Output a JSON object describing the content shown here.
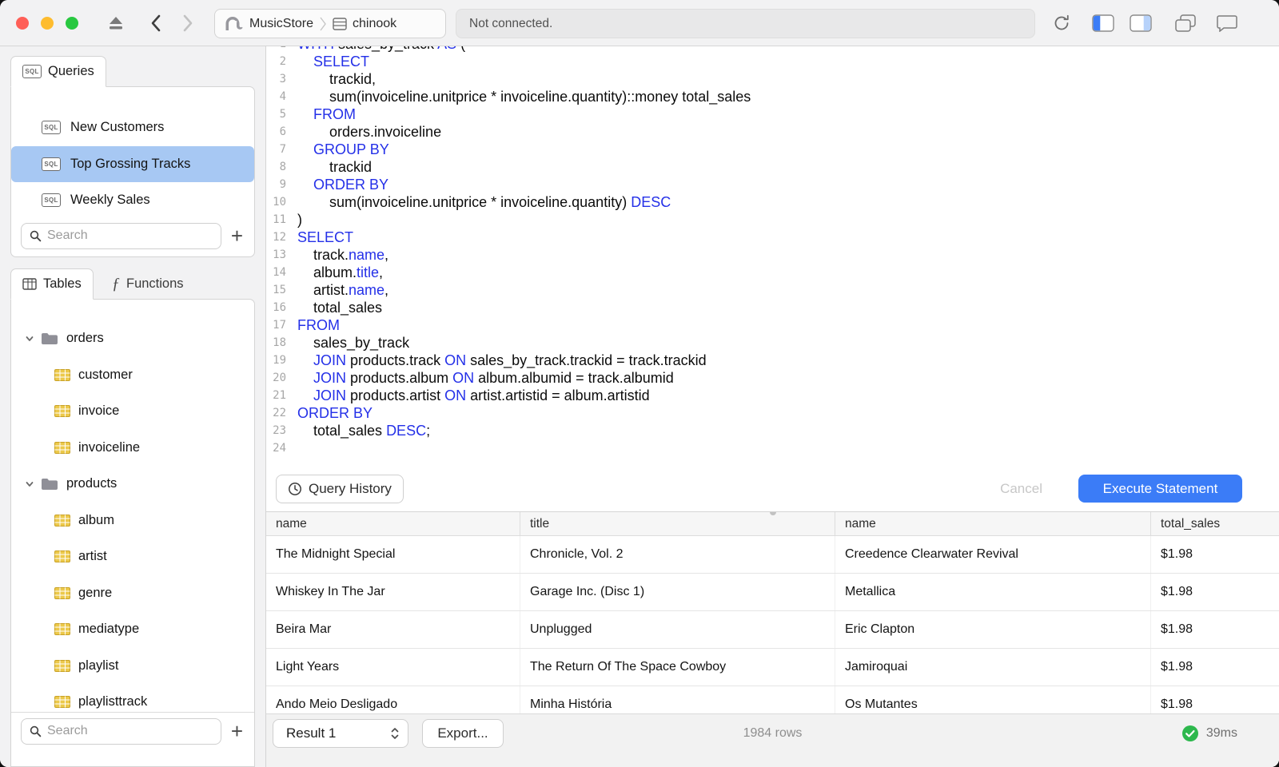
{
  "toolbar": {
    "status_text": "Not connected.",
    "breadcrumb": {
      "server": "MusicStore",
      "database": "chinook"
    }
  },
  "sidebar": {
    "queries_tab_label": "Queries",
    "queries": [
      {
        "label": "New Customers",
        "selected": false
      },
      {
        "label": "Top Grossing Tracks",
        "selected": true
      },
      {
        "label": "Weekly Sales",
        "selected": false
      }
    ],
    "queries_search_placeholder": "Search",
    "tables_tab_label": "Tables",
    "functions_tab_label": "Functions",
    "tree": [
      {
        "kind": "schema",
        "label": "orders"
      },
      {
        "kind": "table",
        "label": "customer"
      },
      {
        "kind": "table",
        "label": "invoice"
      },
      {
        "kind": "table",
        "label": "invoiceline"
      },
      {
        "kind": "schema",
        "label": "products"
      },
      {
        "kind": "table",
        "label": "album"
      },
      {
        "kind": "table",
        "label": "artist"
      },
      {
        "kind": "table",
        "label": "genre"
      },
      {
        "kind": "table",
        "label": "mediatype"
      },
      {
        "kind": "table",
        "label": "playlist"
      },
      {
        "kind": "table",
        "label": "playlisttrack"
      }
    ],
    "tables_search_placeholder": "Search"
  },
  "editor": {
    "first_line_number": 1,
    "lines": [
      [
        [
          "k",
          "WITH"
        ],
        [
          "p",
          " sales_by_track "
        ],
        [
          "k",
          "AS"
        ],
        [
          "p",
          " ("
        ]
      ],
      [
        [
          "p",
          "    "
        ],
        [
          "k",
          "SELECT"
        ]
      ],
      [
        [
          "p",
          "        trackid,"
        ]
      ],
      [
        [
          "p",
          "        sum(invoiceline.unitprice * invoiceline.quantity)::money total_sales"
        ]
      ],
      [
        [
          "p",
          "    "
        ],
        [
          "k",
          "FROM"
        ]
      ],
      [
        [
          "p",
          "        orders.invoiceline"
        ]
      ],
      [
        [
          "p",
          "    "
        ],
        [
          "k",
          "GROUP BY"
        ]
      ],
      [
        [
          "p",
          "        trackid"
        ]
      ],
      [
        [
          "p",
          "    "
        ],
        [
          "k",
          "ORDER BY"
        ]
      ],
      [
        [
          "p",
          "        sum(invoiceline.unitprice * invoiceline.quantity) "
        ],
        [
          "k",
          "DESC"
        ]
      ],
      [
        [
          "p",
          ")"
        ]
      ],
      [
        [
          "k",
          "SELECT"
        ]
      ],
      [
        [
          "p",
          "    track."
        ],
        [
          "k",
          "name"
        ],
        [
          "p",
          ","
        ]
      ],
      [
        [
          "p",
          "    album."
        ],
        [
          "k",
          "title"
        ],
        [
          "p",
          ","
        ]
      ],
      [
        [
          "p",
          "    artist."
        ],
        [
          "k",
          "name"
        ],
        [
          "p",
          ","
        ]
      ],
      [
        [
          "p",
          "    total_sales"
        ]
      ],
      [
        [
          "k",
          "FROM"
        ]
      ],
      [
        [
          "p",
          "    sales_by_track"
        ]
      ],
      [
        [
          "p",
          "    "
        ],
        [
          "k",
          "JOIN"
        ],
        [
          "p",
          " products.track "
        ],
        [
          "k",
          "ON"
        ],
        [
          "p",
          " sales_by_track.trackid = track.trackid"
        ]
      ],
      [
        [
          "p",
          "    "
        ],
        [
          "k",
          "JOIN"
        ],
        [
          "p",
          " products.album "
        ],
        [
          "k",
          "ON"
        ],
        [
          "p",
          " album.albumid = track.albumid"
        ]
      ],
      [
        [
          "p",
          "    "
        ],
        [
          "k",
          "JOIN"
        ],
        [
          "p",
          " products.artist "
        ],
        [
          "k",
          "ON"
        ],
        [
          "p",
          " artist.artistid = album.artistid"
        ]
      ],
      [
        [
          "k",
          "ORDER BY"
        ]
      ],
      [
        [
          "p",
          "    total_sales "
        ],
        [
          "k",
          "DESC"
        ],
        [
          "p",
          ";"
        ]
      ],
      [
        [
          "p",
          ""
        ]
      ]
    ],
    "history_button_label": "Query History",
    "cancel_button_label": "Cancel",
    "execute_button_label": "Execute Statement"
  },
  "results": {
    "columns": [
      "name",
      "title",
      "name",
      "total_sales"
    ],
    "rows": [
      [
        "The Midnight Special",
        "Chronicle, Vol. 2",
        "Creedence Clearwater Revival",
        "$1.98"
      ],
      [
        "Whiskey In The Jar",
        "Garage Inc. (Disc 1)",
        "Metallica",
        "$1.98"
      ],
      [
        "Beira Mar",
        "Unplugged",
        "Eric Clapton",
        "$1.98"
      ],
      [
        "Light Years",
        "The Return Of The Space Cowboy",
        "Jamiroquai",
        "$1.98"
      ],
      [
        "Ando Meio Desligado",
        "Minha História",
        "Os Mutantes",
        "$1.98"
      ]
    ],
    "result_selector_label": "Result 1",
    "export_button_label": "Export...",
    "row_count_text": "1984 rows",
    "elapsed_text": "39ms"
  },
  "colors": {
    "accent_blue": "#3b7cf7",
    "selection_blue": "#a7c8f3",
    "keyword_blue": "#2430e8",
    "success_green": "#2db84d"
  }
}
